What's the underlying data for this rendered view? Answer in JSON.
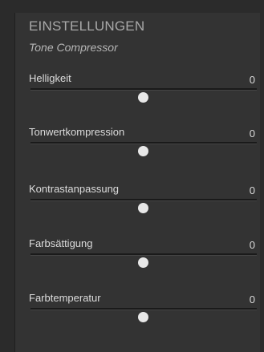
{
  "settings": {
    "title": "EINSTELLUNGEN",
    "subtitle": "Tone Compressor",
    "sliders": [
      {
        "label": "Helligkeit",
        "value": "0",
        "position": 0.5
      },
      {
        "label": "Tonwertkompression",
        "value": "0",
        "position": 0.5
      },
      {
        "label": "Kontrastanpassung",
        "value": "0",
        "position": 0.5
      },
      {
        "label": "Farbsättigung",
        "value": "0",
        "position": 0.5
      },
      {
        "label": "Farbtemperatur",
        "value": "0",
        "position": 0.5
      }
    ]
  }
}
